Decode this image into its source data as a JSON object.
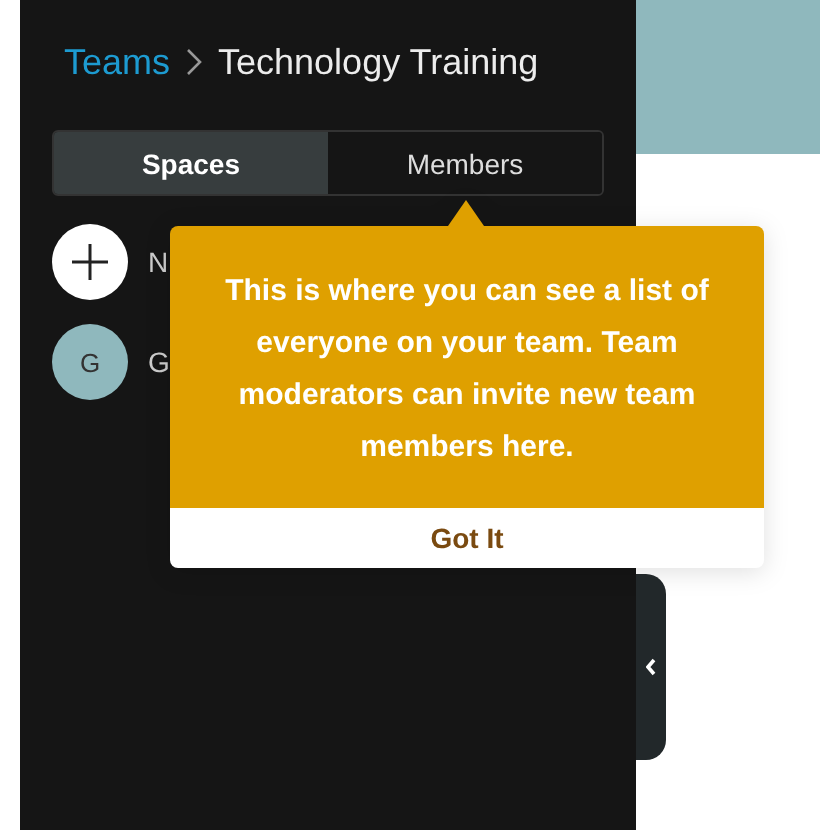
{
  "breadcrumb": {
    "parent": "Teams",
    "current": "Technology Training"
  },
  "tabs": [
    {
      "label": "Spaces",
      "selected": true
    },
    {
      "label": "Members",
      "selected": false
    }
  ],
  "list": [
    {
      "kind": "add",
      "label": "N"
    },
    {
      "kind": "avatar",
      "initial": "G",
      "label": "G"
    }
  ],
  "tooltip": {
    "message": "This is where you can see a list of everyone on your team. Team moderators can invite new team members here.",
    "button": "Got It"
  }
}
